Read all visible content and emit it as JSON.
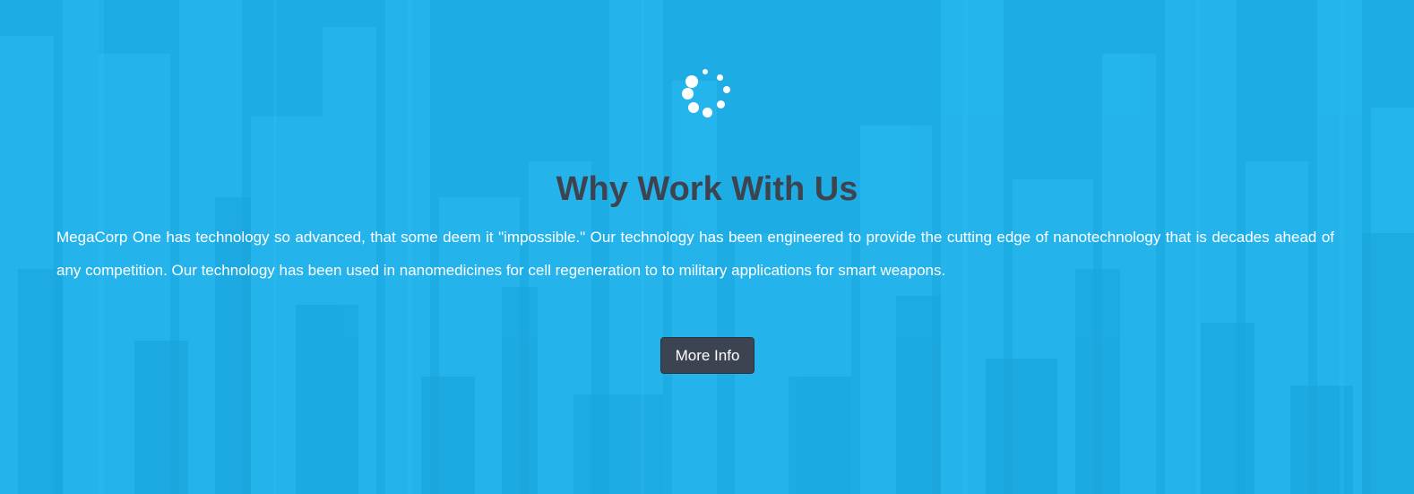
{
  "section": {
    "title": "Why Work With Us",
    "body": "MegaCorp One has technology so advanced, that some deem it \"impossible.\" Our technology has been engineered to provide the cutting edge of nanotechnology that is decades ahead of any competition. Our technology has been used in nanomedicines for cell regeneration to to military applications for smart weapons.",
    "button_label": "More Info"
  },
  "icons": {
    "loading": "spinner-icon"
  },
  "colors": {
    "overlay": "#1fb0e6",
    "title": "#3d4450",
    "button_bg": "#3d4451",
    "text": "#ffffff"
  }
}
